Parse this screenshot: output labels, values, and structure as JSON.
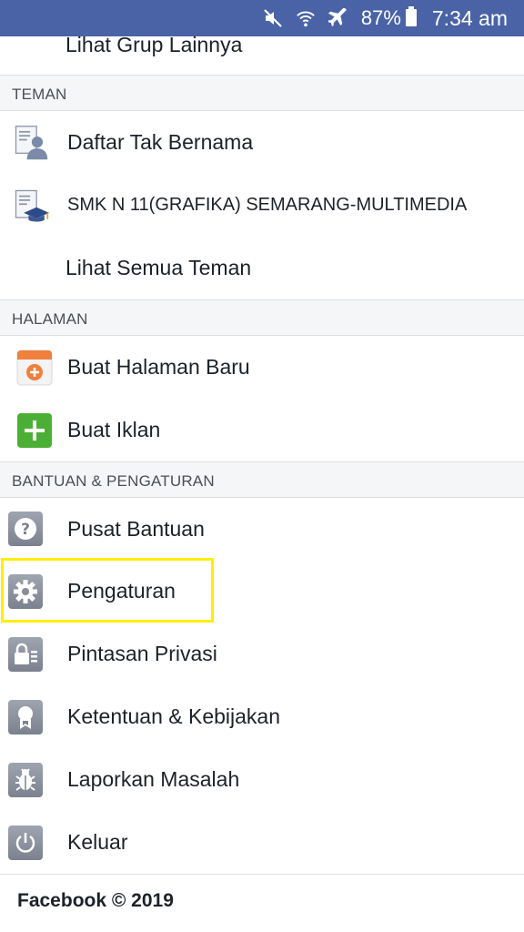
{
  "status_bar": {
    "battery": "87%",
    "time": "7:34 am"
  },
  "top_item": {
    "label": "Lihat Grup Lainnya"
  },
  "sections": {
    "teman": "TEMAN",
    "halaman": "HALAMAN",
    "bantuan": "BANTUAN & PENGATURAN"
  },
  "teman_items": [
    {
      "label": "Daftar Tak Bernama",
      "icon": "friend-list-icon"
    },
    {
      "label": "SMK N 11(GRAFIKA) SEMARANG-MULTIMEDIA",
      "icon": "school-list-icon"
    },
    {
      "label": "Lihat Semua Teman"
    }
  ],
  "halaman_items": [
    {
      "label": "Buat Halaman Baru",
      "icon": "create-page-icon"
    },
    {
      "label": "Buat Iklan",
      "icon": "create-ad-icon"
    }
  ],
  "bantuan_items": [
    {
      "label": "Pusat Bantuan",
      "icon": "help-icon"
    },
    {
      "label": "Pengaturan",
      "icon": "gear-icon"
    },
    {
      "label": "Pintasan Privasi",
      "icon": "privacy-lock-icon"
    },
    {
      "label": "Ketentuan & Kebijakan",
      "icon": "terms-ribbon-icon"
    },
    {
      "label": "Laporkan Masalah",
      "icon": "bug-icon"
    },
    {
      "label": "Keluar",
      "icon": "power-icon"
    }
  ],
  "footer": {
    "text": "Facebook © 2019"
  },
  "colors": {
    "status_bar": "#4a63a6",
    "highlight": "#ffee00",
    "section_bg": "#f5f6f7"
  }
}
